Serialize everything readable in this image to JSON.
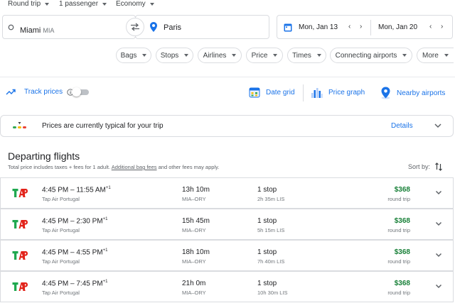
{
  "top": {
    "trip_type": "Round trip",
    "passengers": "1 passenger",
    "cabin": "Economy"
  },
  "search": {
    "origin_city": "Miami",
    "origin_code": "MIA",
    "destination": "Paris",
    "depart_date": "Mon, Jan 13",
    "return_date": "Mon, Jan 20"
  },
  "filters": [
    "Bags",
    "Stops",
    "Airlines",
    "Price",
    "Times",
    "Connecting airports",
    "More"
  ],
  "tools": {
    "track_prices": "Track prices",
    "date_grid": "Date grid",
    "price_graph": "Price graph",
    "nearby_airports": "Nearby airports"
  },
  "insight": {
    "text": "Prices are currently typical for your trip",
    "details": "Details"
  },
  "results": {
    "title": "Departing flights",
    "sub_prefix": "Total price includes taxes + fees for 1 adult. ",
    "sub_link": "Additional bag fees",
    "sub_suffix": " and other fees may apply.",
    "sort_label": "Sort by:"
  },
  "flights": [
    {
      "times": "4:45 PM – 11:55 AM",
      "plus": "+1",
      "airline": "Tap Air Portugal",
      "duration": "13h 10m",
      "route": "MIA–ORY",
      "stops": "1 stop",
      "layover": "2h 35m LIS",
      "price": "$368",
      "price_type": "round trip"
    },
    {
      "times": "4:45 PM – 2:30 PM",
      "plus": "+1",
      "airline": "Tap Air Portugal",
      "duration": "15h 45m",
      "route": "MIA–ORY",
      "stops": "1 stop",
      "layover": "5h 15m LIS",
      "price": "$368",
      "price_type": "round trip"
    },
    {
      "times": "4:45 PM – 4:55 PM",
      "plus": "+1",
      "airline": "Tap Air Portugal",
      "duration": "18h 10m",
      "route": "MIA–ORY",
      "stops": "1 stop",
      "layover": "7h 40m LIS",
      "price": "$368",
      "price_type": "round trip"
    },
    {
      "times": "4:45 PM – 7:45 PM",
      "plus": "+1",
      "airline": "Tap Air Portugal",
      "duration": "21h 0m",
      "route": "MIA–ORY",
      "stops": "1 stop",
      "layover": "10h 30m LIS",
      "price": "$368",
      "price_type": "round trip"
    }
  ],
  "colors": {
    "accent": "#1a73e8",
    "price_green": "#188038",
    "tap_green": "#1fa84f",
    "tap_red": "#e2231a"
  }
}
